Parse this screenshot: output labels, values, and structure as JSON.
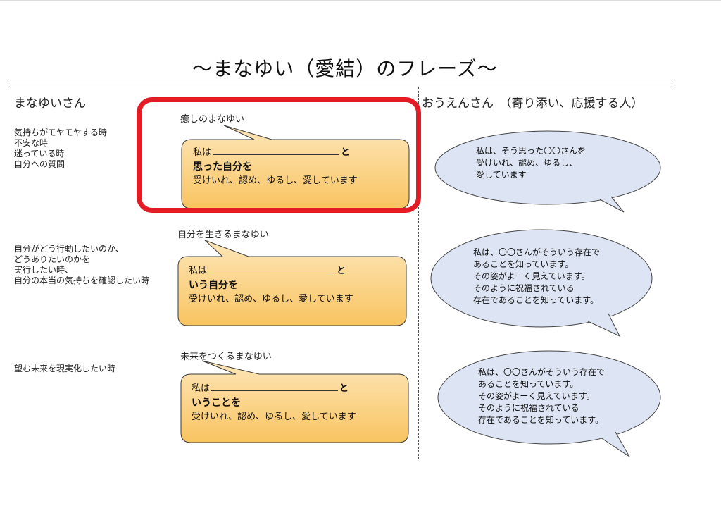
{
  "title": "〜まなゆい（愛結）のフレーズ〜",
  "columns": {
    "left_heading": "まなゆいさん",
    "right_heading": "おうえんさん　（寄り添い、応援する人）"
  },
  "colors": {
    "bubble_fill_top": "#fde6b8",
    "bubble_fill_bottom": "#f9c461",
    "bubble_stroke": "#3a3a3a",
    "cheer_fill": "#dde4f3",
    "highlight": "#e21b25"
  },
  "rows": [
    {
      "situation": [
        "気持ちがモヤモヤする時",
        "不安な時",
        "迷っている時",
        "自分への質問"
      ],
      "phrase_label": "癒しのまなゆい",
      "bubble": {
        "prefix": "私は",
        "suffix": "と",
        "bold_line": "思った自分を",
        "closing_line": "受けいれ、認め、ゆるし、愛しています"
      },
      "cheer": [
        "私は、そう思った〇〇さんを",
        "受けいれ、認め、ゆるし、",
        "愛しています"
      ]
    },
    {
      "situation": [
        "自分がどう行動したいのか、",
        "どうありたいのかを",
        "実行したい時、",
        "自分の本当の気持ちを確認したい時"
      ],
      "phrase_label": "自分を生きるまなゆい",
      "bubble": {
        "prefix": "私は",
        "suffix": "と",
        "bold_line": "いう自分を",
        "closing_line": "受けいれ、認め、ゆるし、愛しています"
      },
      "cheer": [
        "私は、〇〇さんがそういう存在で",
        "あることを知っています。",
        "その姿がよーく見えています。",
        "そのように祝福されている",
        "存在であることを知っています。"
      ]
    },
    {
      "situation": [
        "望む未来を現実化したい時"
      ],
      "phrase_label": "未来をつくるまなゆい",
      "bubble": {
        "prefix": "私は",
        "suffix": "と",
        "bold_line": "いうことを",
        "closing_line": "受けいれ、認め、ゆるし、愛しています"
      },
      "cheer": [
        "私は、〇〇さんがそういう存在で",
        "あることを知っています。",
        "その姿がよーく見えています。",
        "そのように祝福されている",
        "存在であることを知っています。"
      ]
    }
  ]
}
